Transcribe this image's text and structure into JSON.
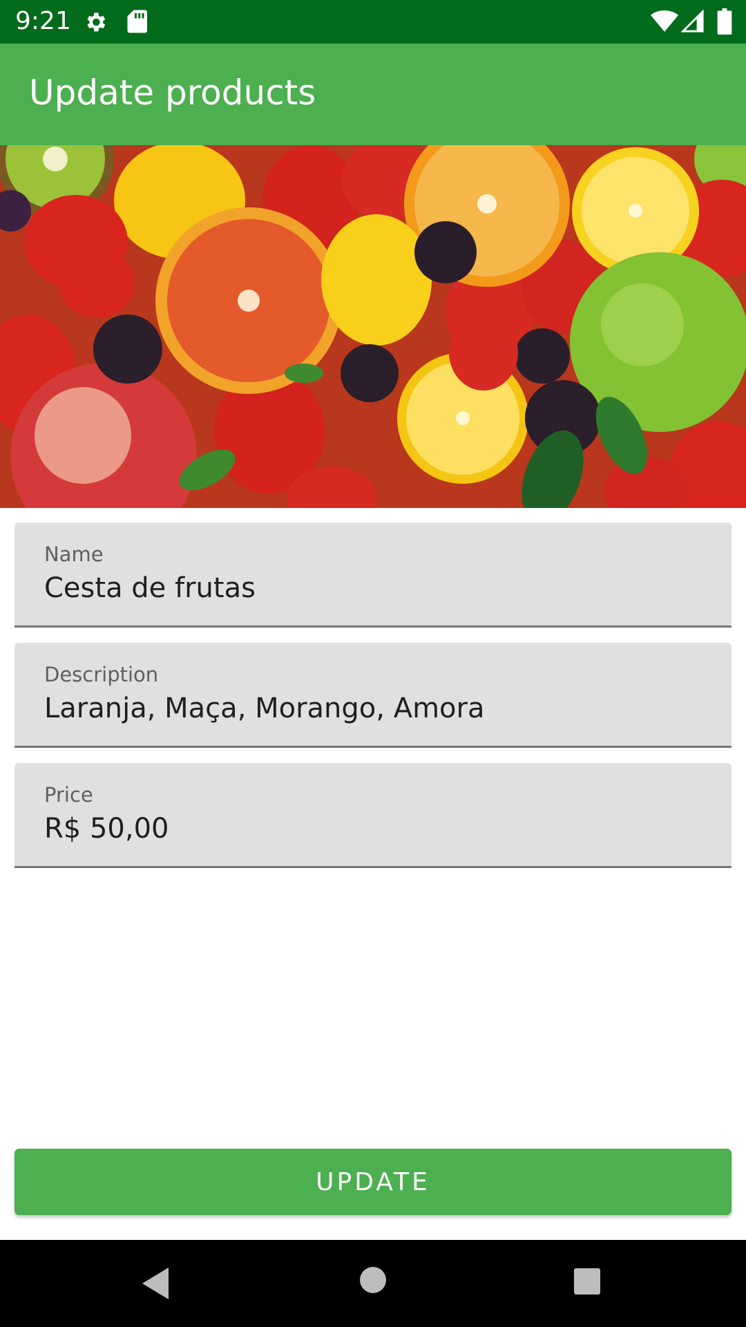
{
  "status_bar": {
    "time": "9:21",
    "icons": [
      "gear-icon",
      "sd-card-icon",
      "wifi-icon",
      "signal-icon",
      "battery-icon"
    ]
  },
  "app_bar": {
    "title": "Update products"
  },
  "hero_image": {
    "subject": "fruit-assortment"
  },
  "form": {
    "name": {
      "label": "Name",
      "value": "Cesta de frutas"
    },
    "description": {
      "label": "Description",
      "value": "Laranja, Maça, Morango, Amora"
    },
    "price": {
      "label": "Price",
      "value": "R$ 50,00"
    }
  },
  "update_button": {
    "label": "UPDATE"
  },
  "nav_bar": {
    "icons": [
      "back-icon",
      "home-icon",
      "recents-icon"
    ]
  },
  "colors": {
    "status_bar": "#006b1b",
    "primary": "#4caf50",
    "field_background": "#e0e0e0"
  }
}
